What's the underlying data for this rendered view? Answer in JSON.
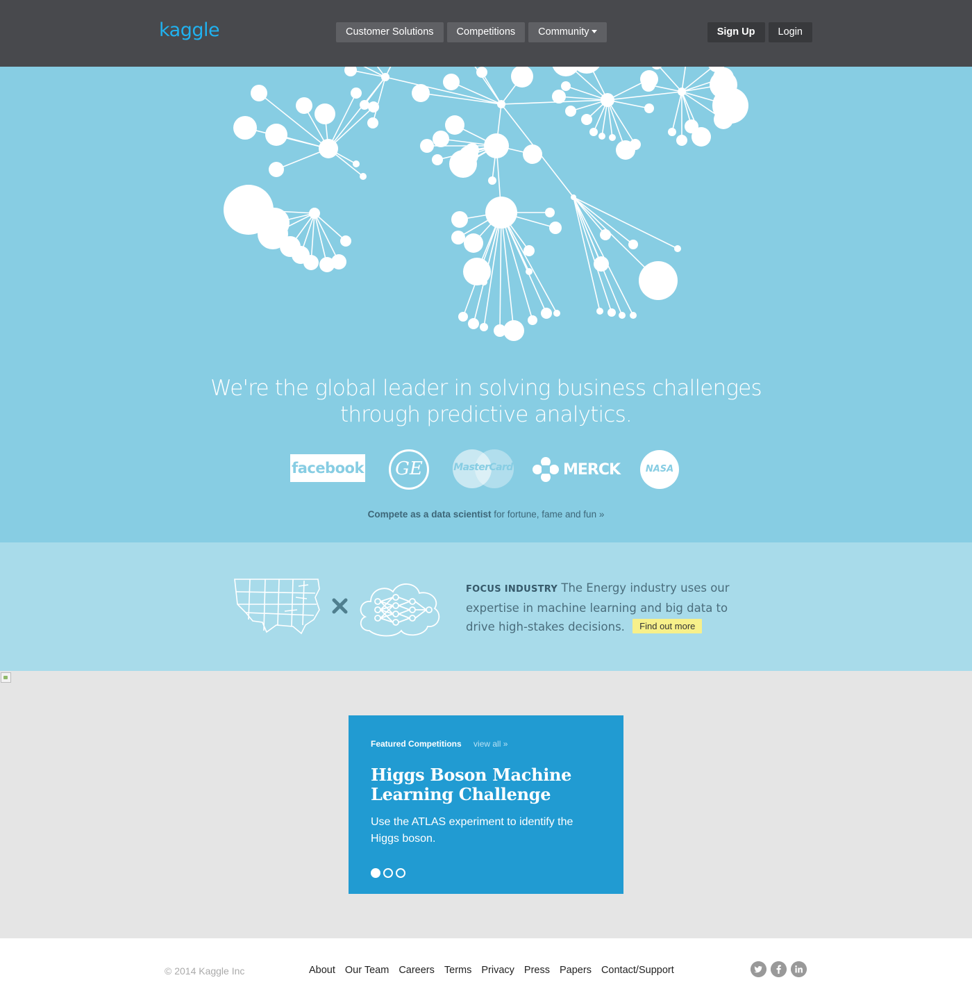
{
  "header": {
    "logo_text": "kaggle",
    "nav": [
      {
        "label": "Customer Solutions"
      },
      {
        "label": "Competitions"
      },
      {
        "label": "Community"
      }
    ],
    "signup_label": "Sign Up",
    "login_label": "Login"
  },
  "hero": {
    "tagline_line1": "We're the global leader in solving business challenges",
    "tagline_line2": "through predictive analytics.",
    "clients": {
      "facebook": "facebook",
      "ge": "GE",
      "mastercard": "MasterCard",
      "merck": "MERCK",
      "nasa": "NASA"
    },
    "compete_bold": "Compete as a data scientist",
    "compete_rest": " for fortune, fame and fun »"
  },
  "focus": {
    "label": "FOCUS INDUSTRY",
    "text": "The Energy industry uses our expertise in machine learning and big data to drive high-stakes decisions.",
    "button": "Find out more"
  },
  "featured": {
    "heading": "Featured Competitions",
    "view_all": "view all »",
    "title": "Higgs Boson Machine Learning Challenge",
    "description": "Use the ATLAS experiment to identify the Higgs boson."
  },
  "footer": {
    "copyright": "© 2014 Kaggle Inc",
    "links": [
      "About",
      "Our Team",
      "Careers",
      "Terms",
      "Privacy",
      "Press",
      "Papers",
      "Contact/Support"
    ]
  },
  "colors": {
    "header_bg": "#48494d",
    "brand": "#20b2f0",
    "hero_bg": "#87cde3",
    "focus_bg": "#a8dbea",
    "card_bg": "#219bd2",
    "cta_yellow": "#f7f08a"
  },
  "icons": [
    "twitter-icon",
    "facebook-icon",
    "linkedin-icon",
    "caret-down-icon"
  ]
}
